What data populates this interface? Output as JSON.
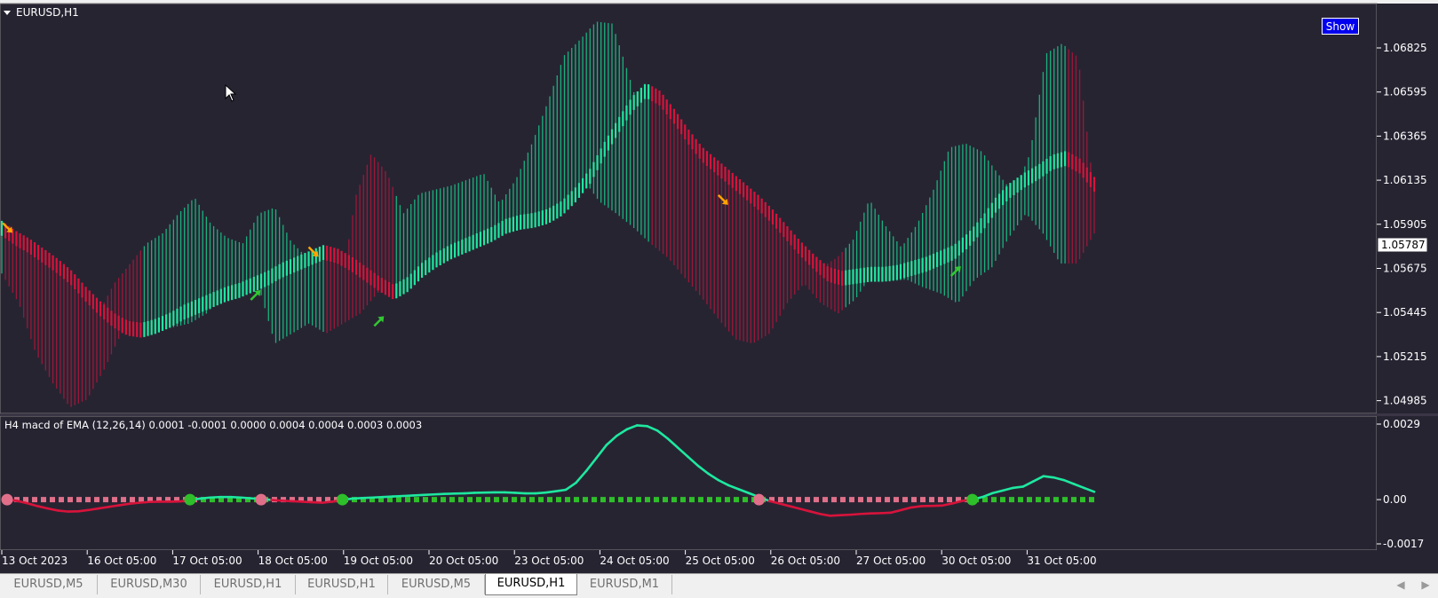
{
  "window": {
    "symbol_title": "EURUSD,H1",
    "show_button": "Show"
  },
  "colors": {
    "background": "#272432",
    "bull": "#1ee89f",
    "bull_dark": "#17c185",
    "bear": "#d8133b",
    "bear_dark": "#a8163a",
    "axis_text": "#ffffff",
    "price_label_bg": "#ffffff",
    "macd_zero_bull": "#2ebf2a",
    "macd_zero_bear": "#e0708a",
    "arrow_up": "#32c832",
    "arrow_down": "#ffa500"
  },
  "price_axis": {
    "ticks": [
      "1.06825",
      "1.06595",
      "1.06365",
      "1.06135",
      "1.05905",
      "1.05675",
      "1.05445",
      "1.05215",
      "1.04985"
    ],
    "current_price": "1.05787"
  },
  "time_axis": {
    "labels": [
      "13 Oct 2023",
      "16 Oct 05:00",
      "17 Oct 05:00",
      "18 Oct 05:00",
      "19 Oct 05:00",
      "20 Oct 05:00",
      "23 Oct 05:00",
      "24 Oct 05:00",
      "25 Oct 05:00",
      "26 Oct 05:00",
      "27 Oct 05:00",
      "30 Oct 05:00",
      "31 Oct 05:00"
    ]
  },
  "indicator": {
    "title": "H4 macd of EMA (12,26,14) 0.0001 -0.0001 0.0000 0.0004 0.0004 0.0003 0.0003",
    "axis_ticks": [
      "0.0029",
      "0.00",
      "-0.0017"
    ]
  },
  "tabs": [
    {
      "label": "EURUSD,M5",
      "active": false
    },
    {
      "label": "EURUSD,M30",
      "active": false
    },
    {
      "label": "EURUSD,H1",
      "active": false
    },
    {
      "label": "EURUSD,H1",
      "active": false
    },
    {
      "label": "EURUSD,M5",
      "active": false
    },
    {
      "label": "EURUSD,H1",
      "active": true
    },
    {
      "label": "EURUSD,M1",
      "active": false
    }
  ],
  "icons": {
    "title_menu": "triangle-down-icon",
    "scroll_left": "scroll-left-icon",
    "scroll_right": "scroll-right-icon",
    "cursor": "mouse-pointer-icon"
  },
  "chart_data": [
    {
      "type": "line",
      "title": "",
      "ylim": [
        1.049,
        1.0695
      ],
      "series": [
        {
          "values": [
            1.0581,
            1.0576,
            1.0572,
            1.0567,
            1.0562,
            1.0556,
            1.0548,
            1.0541,
            1.0535,
            1.0531,
            1.053,
            1.0532,
            1.0535,
            1.0539,
            1.0542,
            1.0545,
            1.0548,
            1.055,
            1.0553,
            1.0556,
            1.056,
            1.0563,
            1.0566,
            1.0569,
            1.0567,
            1.0563,
            1.0558,
            1.0553,
            1.0549,
            1.0553,
            1.056,
            1.0565,
            1.0569,
            1.0572,
            1.0575,
            1.0578,
            1.0582,
            1.0584,
            1.0585,
            1.0587,
            1.0591,
            1.0598,
            1.0607,
            1.062,
            1.0632,
            1.0643,
            1.065,
            1.0646,
            1.0637,
            1.0627,
            1.0618,
            1.0612,
            1.0606,
            1.06,
            1.0594,
            1.0587,
            1.0579,
            1.0571,
            1.0564,
            1.0558,
            1.0556,
            1.0557,
            1.0558,
            1.0558,
            1.0559,
            1.0561,
            1.0563,
            1.0566,
            1.0569,
            1.0575,
            1.0583,
            1.0593,
            1.06,
            1.0605,
            1.0609,
            1.0614,
            1.0616,
            1.0612,
            1.0603
          ]
        },
        {
          "name": "upper",
          "values": [
            1.0583,
            1.0578,
            1.057,
            1.055,
            1.054,
            1.0535,
            1.054,
            1.0555,
            1.0565,
            1.0575,
            1.058,
            1.059,
            1.0598,
            1.0585,
            1.0578,
            1.0575,
            1.059,
            1.0593,
            1.0576,
            1.0568,
            1.056,
            1.0545,
            1.0598,
            1.062,
            1.061,
            1.059,
            1.06,
            1.0602,
            1.0604,
            1.0607,
            1.061,
            1.0595,
            1.0607,
            1.0625,
            1.0646,
            1.0669,
            1.0677,
            1.0686,
            1.0685,
            1.066,
            1.0633,
            1.0602,
            1.0592,
            1.0591,
            1.059,
            1.0587,
            1.0575,
            1.0566,
            1.0563,
            1.0563,
            1.0567,
            1.0563,
            1.0568,
            1.0577,
            1.0597,
            1.0584,
            1.0573,
            1.0585,
            1.0602,
            1.0623,
            1.0625,
            1.0621,
            1.061,
            1.06,
            1.062,
            1.067,
            1.0675,
            1.0668,
            1.06
          ]
        },
        {
          "name": "lower",
          "values": [
            1.056,
            1.0545,
            1.052,
            1.0505,
            1.0493,
            1.0497,
            1.0512,
            1.053,
            1.053,
            1.0532,
            1.0533,
            1.0535,
            1.054,
            1.055,
            1.056,
            1.0555,
            1.0525,
            1.053,
            1.0535,
            1.053,
            1.0535,
            1.054,
            1.055,
            1.056,
            1.057,
            1.0575,
            1.058,
            1.0583,
            1.0586,
            1.059,
            1.0608,
            1.064,
            1.065,
            1.0628,
            1.0608,
            1.0596,
            1.059,
            1.0583,
            1.0575,
            1.0568,
            1.0558,
            1.0548,
            1.0537,
            1.0527,
            1.0525,
            1.053,
            1.0545,
            1.0555,
            1.0545,
            1.054,
            1.0547,
            1.056,
            1.0556,
            1.0557,
            1.0553,
            1.055,
            1.0545,
            1.0557,
            1.0563,
            1.0578,
            1.059,
            1.058,
            1.0565,
            1.0565,
            1.058
          ]
        }
      ]
    },
    {
      "type": "line",
      "title": "H4 macd of EMA (12,26,14) 0.0001 -0.0001 0.0000 0.0004 0.0004 0.0003 0.0003",
      "ylim": [
        -0.0017,
        0.0029
      ],
      "series": [
        {
          "values": [
            0.0,
            -5e-05,
            -0.00014,
            -0.00025,
            -0.00034,
            -0.00042,
            -0.00046,
            -0.00045,
            -0.0004,
            -0.00034,
            -0.00028,
            -0.00022,
            -0.00016,
            -0.00012,
            -9e-05,
            -8e-05,
            -8e-05,
            -7e-05,
            -2e-05,
            4e-05,
            8e-05,
            0.0001,
            0.0001,
            8e-05,
            5e-05,
            2e-05,
            -1e-05,
            -4e-05,
            -6e-05,
            -8e-05,
            -0.0001,
            -0.00012,
            -8e-05,
            -1e-05,
            4e-05,
            6e-05,
            8e-05,
            0.0001,
            0.00012,
            0.00014,
            0.00016,
            0.00018,
            0.0002,
            0.00022,
            0.00023,
            0.00024,
            0.00026,
            0.00027,
            0.00028,
            0.00028,
            0.00026,
            0.00024,
            0.00024,
            0.00027,
            0.00032,
            0.00038,
            0.00065,
            0.0011,
            0.0016,
            0.0021,
            0.00245,
            0.0027,
            0.00285,
            0.00282,
            0.00265,
            0.00235,
            0.002,
            0.00165,
            0.0013,
            0.001,
            0.00075,
            0.00055,
            0.0004,
            0.00025,
            0.0001,
            -5e-05,
            -0.00015,
            -0.00025,
            -0.00035,
            -0.00045,
            -0.00055,
            -0.00062,
            -0.0006,
            -0.00058,
            -0.00055,
            -0.00053,
            -0.00052,
            -0.0005,
            -0.0004,
            -0.0003,
            -0.00025,
            -0.00024,
            -0.00023,
            -0.00015,
            -5e-05,
            0.0,
            0.0001,
            0.00025,
            0.00035,
            0.00045,
            0.0005,
            0.0007,
            0.0009,
            0.00085,
            0.00075,
            0.0006,
            0.00045,
            0.0003
          ]
        }
      ]
    }
  ]
}
